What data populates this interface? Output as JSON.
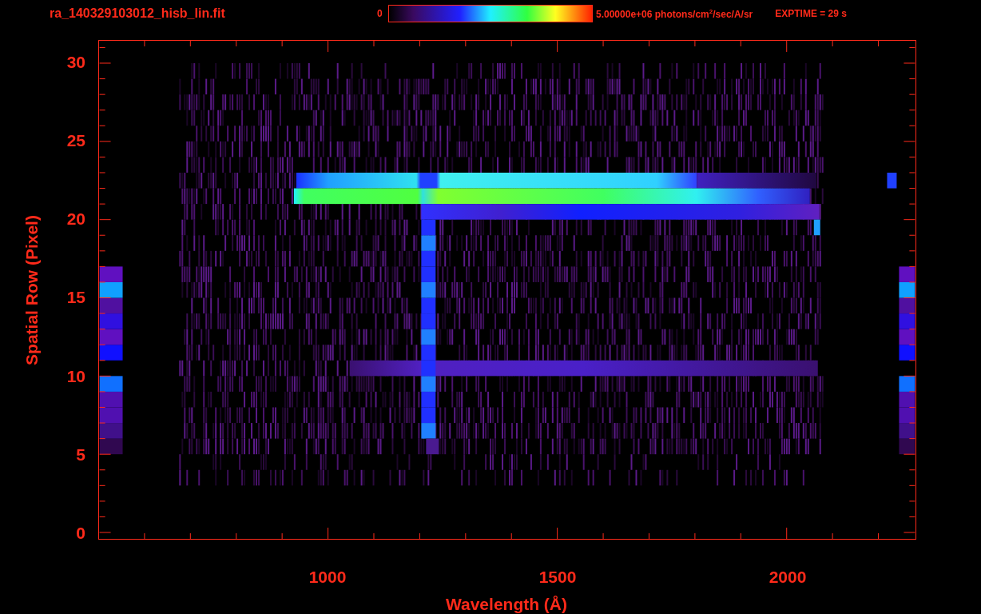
{
  "title": "ra_140329103012_hisb_lin.fit",
  "colorbar": {
    "min_label": "0",
    "max_label": "5.00000e+06 photons/cm$^{2}$/sec/A/sr"
  },
  "exptime": "EXPTIME = 29 s",
  "y_axis": {
    "title": "Spatial Row (Pixel)",
    "ticks": [
      "30",
      "25",
      "20",
      "15",
      "10",
      "5",
      "0"
    ]
  },
  "x_axis": {
    "title": "Wavelength (Å)",
    "ticks": [
      "1000",
      "1500",
      "2000"
    ]
  }
}
